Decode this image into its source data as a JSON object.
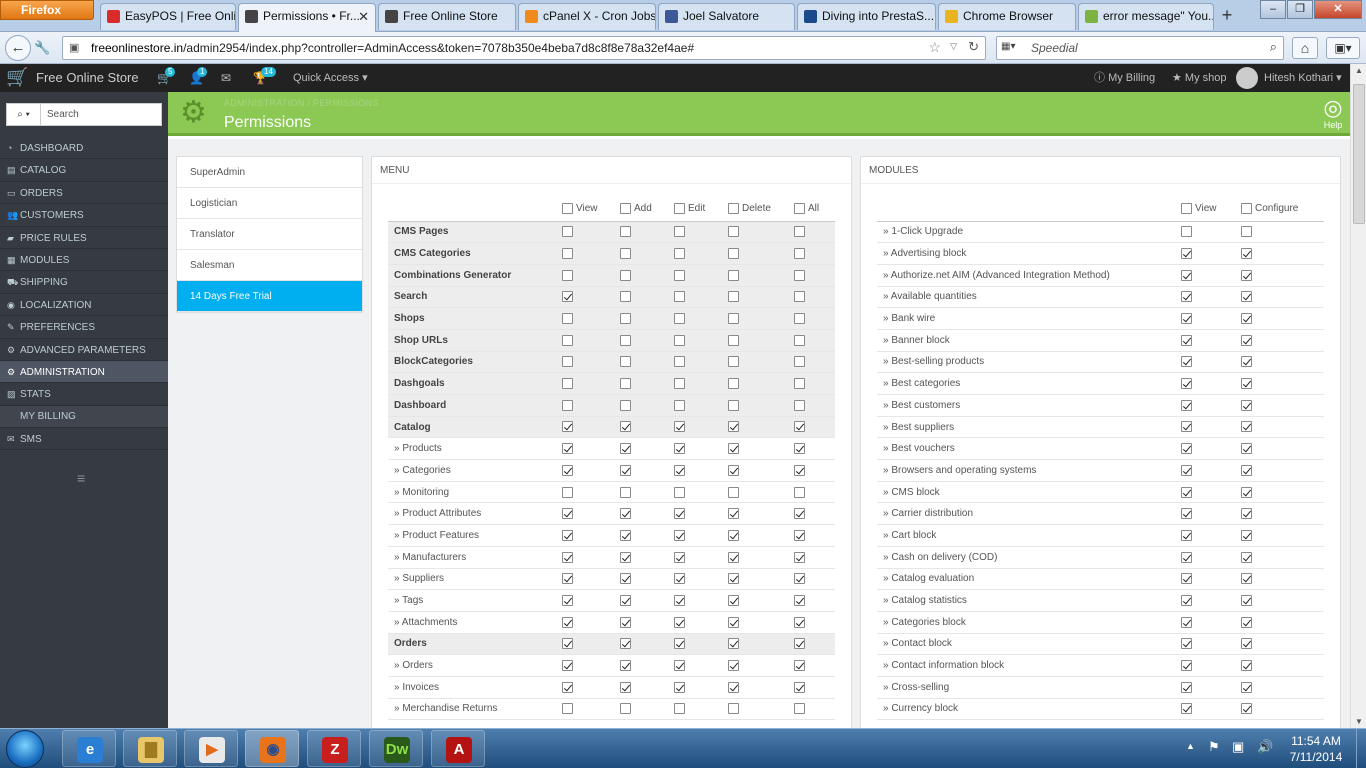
{
  "browser": {
    "menu_label": "Firefox",
    "tabs": [
      {
        "title": "EasyPOS | Free Onli...",
        "icon_color": "#d92b2b",
        "active": false
      },
      {
        "title": "Permissions • Fr...",
        "icon_color": "#444",
        "active": true
      },
      {
        "title": "Free Online Store",
        "icon_color": "#444",
        "active": false
      },
      {
        "title": "cPanel X - Cron Jobs",
        "icon_color": "#f08a1c",
        "active": false
      },
      {
        "title": "Joel Salvatore",
        "icon_color": "#3b5998",
        "active": false
      },
      {
        "title": "Diving into PrestaS...",
        "icon_color": "#1a4a8a",
        "active": false
      },
      {
        "title": "Chrome Browser",
        "icon_color": "#e8b521",
        "active": false
      },
      {
        "title": "error message\" You...",
        "icon_color": "#7cb342",
        "active": false
      }
    ],
    "new_tab": "+",
    "url_host": "freeonlinestore.in",
    "url_path": "/admin2954/index.php?controller=AdminAccess&token=7078b350e4beba7d8c8f8e78a32ef4ae#",
    "search_placeholder": "Speedial"
  },
  "header": {
    "brand": "Free Online Store",
    "cart_badge": "5",
    "customers_badge": "1",
    "trophy_badge": "14",
    "quick_access": "Quick Access ▾",
    "my_billing": "My Billing",
    "my_shop": "My shop",
    "user": "Hitesh Kothari ▾"
  },
  "sidebar": {
    "search_placeholder": "Search",
    "items": [
      {
        "label": "DASHBOARD",
        "icon": "dashboard-icon",
        "glyph": "◔"
      },
      {
        "label": "CATALOG",
        "icon": "catalog-icon",
        "glyph": "▤"
      },
      {
        "label": "ORDERS",
        "icon": "orders-icon",
        "glyph": "▭"
      },
      {
        "label": "CUSTOMERS",
        "icon": "customers-icon",
        "glyph": "👥"
      },
      {
        "label": "PRICE RULES",
        "icon": "price-rules-icon",
        "glyph": "▰"
      },
      {
        "label": "MODULES",
        "icon": "modules-icon",
        "glyph": "▦"
      },
      {
        "label": "SHIPPING",
        "icon": "shipping-icon",
        "glyph": "⛟"
      },
      {
        "label": "LOCALIZATION",
        "icon": "localization-icon",
        "glyph": "◉"
      },
      {
        "label": "PREFERENCES",
        "icon": "preferences-icon",
        "glyph": "✎"
      },
      {
        "label": "ADVANCED PARAMETERS",
        "icon": "advanced-parameters-icon",
        "glyph": "⚙"
      },
      {
        "label": "ADMINISTRATION",
        "icon": "administration-icon",
        "glyph": "⚙",
        "active": true
      },
      {
        "label": "STATS",
        "icon": "stats-icon",
        "glyph": "▨"
      },
      {
        "label": "MY BILLING",
        "icon": "",
        "glyph": "",
        "sub": true
      },
      {
        "label": "SMS",
        "icon": "sms-icon",
        "glyph": "✉"
      }
    ]
  },
  "page": {
    "breadcrumb": "ADMINISTRATION  /  PERMISSIONS",
    "title": "Permissions",
    "help": "Help"
  },
  "profiles": [
    "SuperAdmin",
    "Logistician",
    "Translator",
    "Salesman",
    "14 Days Free Trial"
  ],
  "menu_panel": {
    "heading": "MENU",
    "columns": [
      "View",
      "Add",
      "Edit",
      "Delete",
      "All"
    ],
    "rows": [
      {
        "label": "CMS Pages",
        "group": true,
        "v": [
          0,
          0,
          0,
          0,
          0
        ]
      },
      {
        "label": "CMS Categories",
        "group": true,
        "v": [
          0,
          0,
          0,
          0,
          0
        ]
      },
      {
        "label": "Combinations Generator",
        "group": true,
        "v": [
          0,
          0,
          0,
          0,
          0
        ]
      },
      {
        "label": "Search",
        "group": true,
        "v": [
          1,
          0,
          0,
          0,
          0
        ]
      },
      {
        "label": "Shops",
        "group": true,
        "v": [
          0,
          0,
          0,
          0,
          0
        ]
      },
      {
        "label": "Shop URLs",
        "group": true,
        "v": [
          0,
          0,
          0,
          0,
          0
        ]
      },
      {
        "label": "BlockCategories",
        "group": true,
        "v": [
          0,
          0,
          0,
          0,
          0
        ]
      },
      {
        "label": "Dashgoals",
        "group": true,
        "v": [
          0,
          0,
          0,
          0,
          0
        ]
      },
      {
        "label": "Dashboard",
        "group": true,
        "v": [
          0,
          0,
          0,
          0,
          0
        ]
      },
      {
        "label": "Catalog",
        "group": true,
        "v": [
          1,
          1,
          1,
          1,
          1
        ]
      },
      {
        "label": "» Products",
        "group": false,
        "v": [
          1,
          1,
          1,
          1,
          1
        ]
      },
      {
        "label": "» Categories",
        "group": false,
        "v": [
          1,
          1,
          1,
          1,
          1
        ]
      },
      {
        "label": "» Monitoring",
        "group": false,
        "v": [
          0,
          0,
          0,
          0,
          0
        ]
      },
      {
        "label": "» Product Attributes",
        "group": false,
        "v": [
          1,
          1,
          1,
          1,
          1
        ]
      },
      {
        "label": "» Product Features",
        "group": false,
        "v": [
          1,
          1,
          1,
          1,
          1
        ]
      },
      {
        "label": "» Manufacturers",
        "group": false,
        "v": [
          1,
          1,
          1,
          1,
          1
        ]
      },
      {
        "label": "» Suppliers",
        "group": false,
        "v": [
          1,
          1,
          1,
          1,
          1
        ]
      },
      {
        "label": "» Tags",
        "group": false,
        "v": [
          1,
          1,
          1,
          1,
          1
        ]
      },
      {
        "label": "» Attachments",
        "group": false,
        "v": [
          1,
          1,
          1,
          1,
          1
        ]
      },
      {
        "label": "Orders",
        "group": true,
        "v": [
          1,
          1,
          1,
          1,
          1
        ]
      },
      {
        "label": "» Orders",
        "group": false,
        "v": [
          1,
          1,
          1,
          1,
          1
        ]
      },
      {
        "label": "» Invoices",
        "group": false,
        "v": [
          1,
          1,
          1,
          1,
          1
        ]
      },
      {
        "label": "» Merchandise Returns",
        "group": false,
        "v": [
          0,
          0,
          0,
          0,
          0
        ]
      }
    ]
  },
  "modules_panel": {
    "heading": "MODULES",
    "columns": [
      "View",
      "Configure"
    ],
    "rows": [
      {
        "label": "» 1-Click Upgrade",
        "v": [
          0,
          0
        ]
      },
      {
        "label": "» Advertising block",
        "v": [
          1,
          1
        ]
      },
      {
        "label": "» Authorize.net AIM (Advanced Integration Method)",
        "v": [
          1,
          1
        ]
      },
      {
        "label": "» Available quantities",
        "v": [
          1,
          1
        ]
      },
      {
        "label": "» Bank wire",
        "v": [
          1,
          1
        ]
      },
      {
        "label": "» Banner block",
        "v": [
          1,
          1
        ]
      },
      {
        "label": "» Best-selling products",
        "v": [
          1,
          1
        ]
      },
      {
        "label": "» Best categories",
        "v": [
          1,
          1
        ]
      },
      {
        "label": "» Best customers",
        "v": [
          1,
          1
        ]
      },
      {
        "label": "» Best suppliers",
        "v": [
          1,
          1
        ]
      },
      {
        "label": "» Best vouchers",
        "v": [
          1,
          1
        ]
      },
      {
        "label": "» Browsers and operating systems",
        "v": [
          1,
          1
        ]
      },
      {
        "label": "» CMS block",
        "v": [
          1,
          1
        ]
      },
      {
        "label": "» Carrier distribution",
        "v": [
          1,
          1
        ]
      },
      {
        "label": "» Cart block",
        "v": [
          1,
          1
        ]
      },
      {
        "label": "» Cash on delivery (COD)",
        "v": [
          1,
          1
        ]
      },
      {
        "label": "» Catalog evaluation",
        "v": [
          1,
          1
        ]
      },
      {
        "label": "» Catalog statistics",
        "v": [
          1,
          1
        ]
      },
      {
        "label": "» Categories block",
        "v": [
          1,
          1
        ]
      },
      {
        "label": "» Contact block",
        "v": [
          1,
          1
        ]
      },
      {
        "label": "» Contact information block",
        "v": [
          1,
          1
        ]
      },
      {
        "label": "» Cross-selling",
        "v": [
          1,
          1
        ]
      },
      {
        "label": "» Currency block",
        "v": [
          1,
          1
        ]
      }
    ]
  },
  "taskbar": {
    "apps": [
      {
        "name": "internet-explorer-app",
        "glyph": "e",
        "bg": "#2a7fd4",
        "fg": "#fff"
      },
      {
        "name": "file-explorer-app",
        "glyph": "▇",
        "bg": "#e8c66a",
        "fg": "#a07a20"
      },
      {
        "name": "media-player-app",
        "glyph": "▶",
        "bg": "#e9e9e9",
        "fg": "#e06b1a"
      },
      {
        "name": "firefox-app",
        "glyph": "◉",
        "bg": "#e8731a",
        "fg": "#2b4c8a"
      },
      {
        "name": "filezilla-app",
        "glyph": "Z",
        "bg": "#c81e1e",
        "fg": "#fff"
      },
      {
        "name": "dreamweaver-app",
        "glyph": "Dw",
        "bg": "#2a5a1a",
        "fg": "#8ee04a"
      },
      {
        "name": "adobe-reader-app",
        "glyph": "A",
        "bg": "#b51212",
        "fg": "#fff"
      }
    ],
    "time": "11:54 AM",
    "date": "7/11/2014"
  }
}
